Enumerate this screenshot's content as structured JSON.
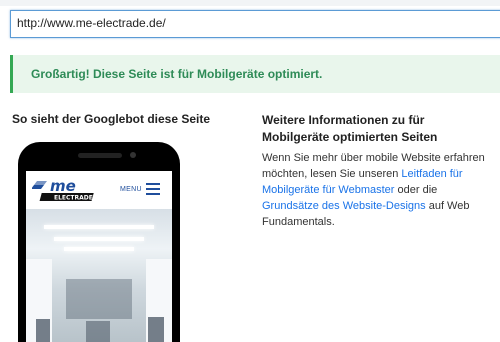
{
  "url_bar": {
    "value": "http://www.me-electrade.de/"
  },
  "result": {
    "message": "Großartig! Diese Seite ist für Mobilgeräte optimiert."
  },
  "preview": {
    "heading": "So sieht der Googlebot diese Seite",
    "site": {
      "logo_text": "me",
      "logo_subtext": "ELECTRADE",
      "menu_label": "MENU"
    }
  },
  "info": {
    "heading": "Weitere Informationen zu für Mobilgeräte optimierten Seiten",
    "text_1": "Wenn Sie mehr über mobile Website erfahren möchten, lesen Sie unseren ",
    "link_1": "Leitfaden für Mobilgeräte für Webmaster",
    "text_2": " oder die ",
    "link_2": "Grundsätze des Website-Designs",
    "text_3": " auf Web Fundamentals."
  },
  "colors": {
    "success_text": "#2e8b57",
    "success_bg": "#e9f6ec",
    "link": "#1a73e8",
    "brand_blue": "#1f4e9c"
  }
}
